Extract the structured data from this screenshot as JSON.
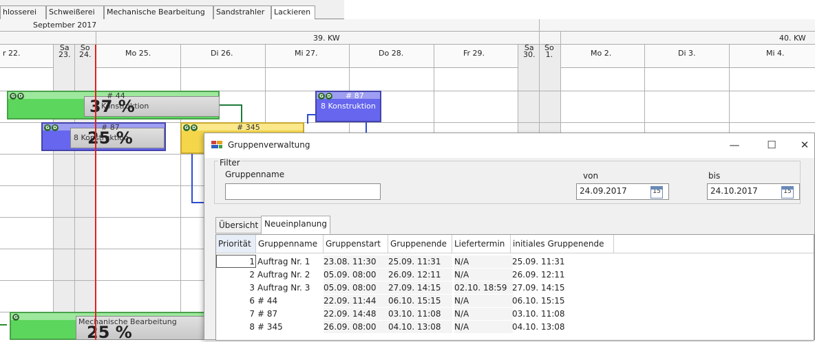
{
  "tabs": [
    "hlosserei",
    "Schweißerei",
    "Mechanische Bearbeitung",
    "Sandstrahler",
    "Lackieren"
  ],
  "gantt": {
    "month": "September 2017",
    "weeks": [
      "39. KW",
      "40. KW"
    ],
    "days": [
      {
        "top": "",
        "bottom": "r 22."
      },
      {
        "top": "Sa",
        "bottom": "23."
      },
      {
        "top": "So",
        "bottom": "24."
      },
      {
        "top": "",
        "bottom": "Mo 25."
      },
      {
        "top": "",
        "bottom": "Di 26."
      },
      {
        "top": "",
        "bottom": "Mi 27."
      },
      {
        "top": "",
        "bottom": "Do 28."
      },
      {
        "top": "",
        "bottom": "Fr 29."
      },
      {
        "top": "Sa",
        "bottom": "30."
      },
      {
        "top": "So",
        "bottom": "1."
      },
      {
        "top": "",
        "bottom": "Mo 2."
      },
      {
        "top": "",
        "bottom": "Di 3."
      },
      {
        "top": "",
        "bottom": "Mi 4."
      }
    ],
    "bars": [
      {
        "id": "# 44",
        "label": "Konstruktion",
        "pct": "37 %",
        "badge": "GD",
        "color": "#5cd65c"
      },
      {
        "id": "# 87",
        "label": "8 Konstruktion",
        "pct": "25 %",
        "badge": "GD",
        "color": "#6666ee"
      },
      {
        "id": "# 345",
        "label": "",
        "pct": "",
        "badge": "GD",
        "color": "#f5d64a"
      },
      {
        "id": "# 87",
        "label": "8 Konstruktion",
        "pct": "",
        "badge": "GD",
        "color": "#6666ee"
      },
      {
        "id": "",
        "label": "Mechanische Bearbeitung",
        "pct": "25 %",
        "badge": "G",
        "color": "#5cd65c"
      }
    ],
    "colors": {
      "green": "#5cd65c",
      "blue": "#6666ee",
      "yellow": "#f5d64a",
      "today": "#e02020"
    }
  },
  "dialog": {
    "title": "Gruppenverwaltung",
    "filter_label": "Filter",
    "name_label": "Gruppenname",
    "name_value": "",
    "from_label": "von",
    "from_value": "24.09.2017",
    "to_label": "bis",
    "to_value": "24.10.2017",
    "cal_icon_text": "15",
    "tabs": [
      "Übersicht",
      "Neueinplanung"
    ],
    "columns": [
      "Priorität",
      "Gruppenname",
      "Gruppenstart",
      "Gruppenende",
      "Liefertermin",
      "initiales Gruppenende"
    ],
    "rows": [
      [
        "1",
        "Auftrag Nr. 1",
        "23.08. 11:30",
        "25.09. 11:31",
        "N/A",
        "25.09. 11:31"
      ],
      [
        "2",
        "Auftrag Nr. 2",
        "05.09. 08:00",
        "26.09. 12:11",
        "N/A",
        "26.09. 12:11"
      ],
      [
        "3",
        "Auftrag Nr. 3",
        "05.09. 08:00",
        "27.09. 14:15",
        "02.10. 18:59",
        "27.09. 14:15"
      ],
      [
        "6",
        "# 44",
        "22.09. 11:44",
        "06.10. 15:15",
        "N/A",
        "06.10. 15:15"
      ],
      [
        "7",
        "# 87",
        "22.09. 14:48",
        "03.10. 11:08",
        "N/A",
        "03.10. 11:08"
      ],
      [
        "8",
        "# 345",
        "26.09. 08:00",
        "04.10. 13:08",
        "N/A",
        "04.10. 13:08"
      ]
    ]
  }
}
